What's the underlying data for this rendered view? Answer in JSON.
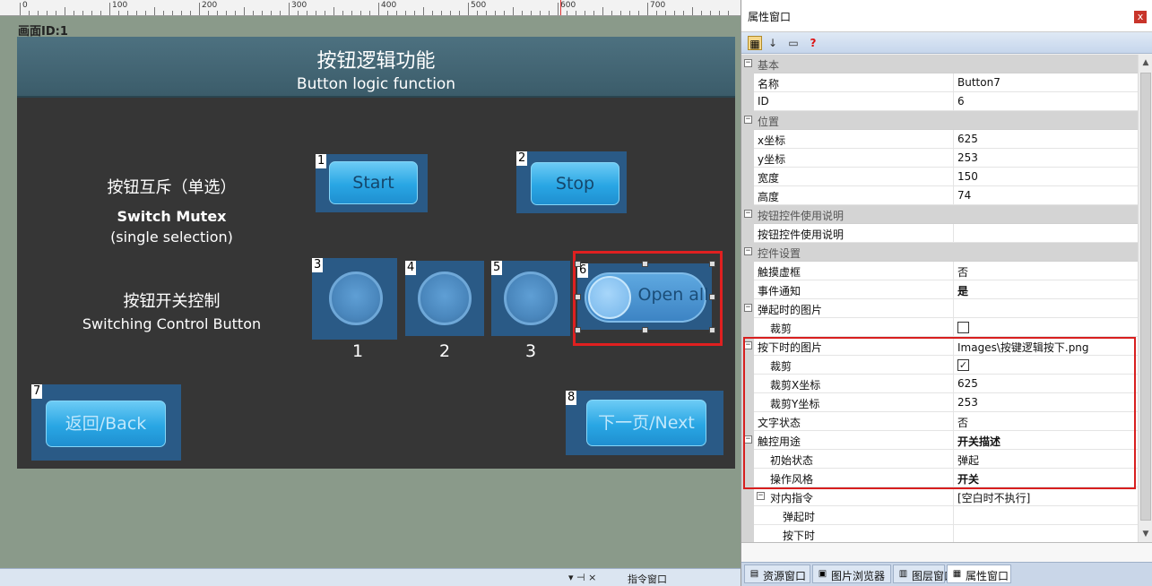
{
  "ruler": {
    "labels": [
      "0",
      "100",
      "200",
      "300",
      "400",
      "500",
      "600",
      "700"
    ]
  },
  "screen_label": "画面ID:1",
  "hmi": {
    "title": "按钮逻辑功能",
    "subtitle": "Button logic function",
    "mutex_label_cn": "按钮互斥（单选）",
    "mutex_label_en1": "Switch Mutex",
    "mutex_label_en2": "(single selection)",
    "switch_label_cn": "按钮开关控制",
    "switch_label_en": "Switching Control Button",
    "buttons": {
      "start": {
        "num": "1",
        "label": "Start"
      },
      "stop": {
        "num": "2",
        "label": "Stop"
      },
      "c1": {
        "num": "3",
        "caption": "1"
      },
      "c2": {
        "num": "4",
        "caption": "2"
      },
      "c3": {
        "num": "5",
        "caption": "3"
      },
      "open_all": {
        "num": "6",
        "label": "Open all"
      },
      "back": {
        "num": "7",
        "label": "返回/Back"
      },
      "next": {
        "num": "8",
        "label": "下一页/Next"
      }
    }
  },
  "panel": {
    "title": "属性窗口",
    "close": "x",
    "rows": [
      {
        "type": "cat",
        "name": "基本",
        "sign": "−"
      },
      {
        "name": "名称",
        "value": "Button7"
      },
      {
        "name": "ID",
        "value": "6"
      },
      {
        "type": "cat",
        "name": "位置",
        "sign": "−"
      },
      {
        "name": "x坐标",
        "value": "625"
      },
      {
        "name": "y坐标",
        "value": "253"
      },
      {
        "name": "宽度",
        "value": "150"
      },
      {
        "name": "高度",
        "value": "74"
      },
      {
        "type": "cat",
        "name": "按钮控件使用说明",
        "sign": "−"
      },
      {
        "name": "按钮控件使用说明",
        "value": ""
      },
      {
        "type": "cat",
        "name": "控件设置",
        "sign": "−"
      },
      {
        "name": "触摸虚框",
        "value": "否"
      },
      {
        "name": "事件通知",
        "value": "是",
        "bold": true
      },
      {
        "name": "弹起时的图片",
        "value": "",
        "sign": "−"
      },
      {
        "name": "裁剪",
        "value": "",
        "indent": 1,
        "check": ""
      },
      {
        "name": "按下时的图片",
        "value": "Images\\按键逻辑按下.png",
        "sign": "−"
      },
      {
        "name": "裁剪",
        "value": "",
        "indent": 1,
        "check": "✓"
      },
      {
        "name": "裁剪X坐标",
        "value": "625",
        "indent": 1
      },
      {
        "name": "裁剪Y坐标",
        "value": "253",
        "indent": 1
      },
      {
        "name": "文字状态",
        "value": "否"
      },
      {
        "name": "触控用途",
        "value": "开关描述",
        "bold": true,
        "sign": "−"
      },
      {
        "name": "初始状态",
        "value": "弹起",
        "indent": 1
      },
      {
        "name": "操作风格",
        "value": "开关",
        "bold": true,
        "indent": 1
      },
      {
        "name": "对内指令",
        "value": "[空白时不执行]",
        "indent": 1,
        "sign": "−"
      },
      {
        "name": "弹起时",
        "value": "",
        "indent": 2
      },
      {
        "name": "按下时",
        "value": "",
        "indent": 2
      }
    ],
    "tabs": [
      {
        "label": "资源窗口",
        "icon": "resource-icon"
      },
      {
        "label": "图片浏览器",
        "icon": "image-icon"
      },
      {
        "label": "图层窗口",
        "icon": "layer-icon"
      },
      {
        "label": "属性窗口",
        "icon": "property-icon"
      }
    ]
  },
  "bottom_strip": {
    "pin": "▾ ⊣ ×",
    "label": "指令窗口"
  }
}
